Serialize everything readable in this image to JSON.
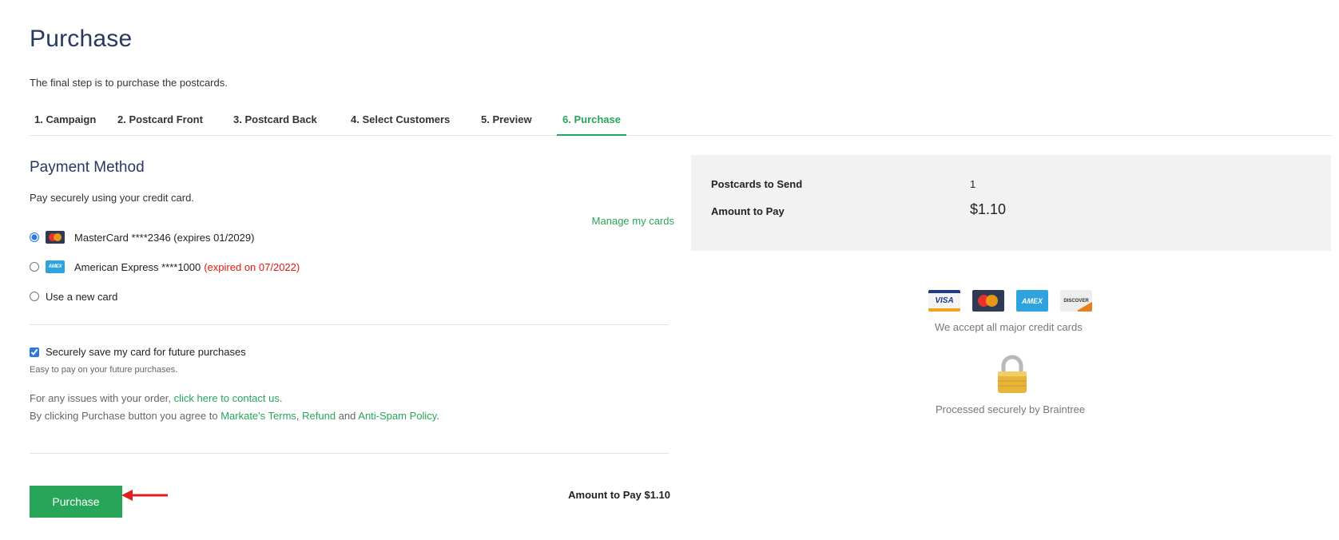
{
  "page": {
    "title": "Purchase",
    "intro": "The final step is to purchase the postcards."
  },
  "steps": [
    {
      "label": "1. Campaign",
      "active": false
    },
    {
      "label": "2. Postcard Front",
      "active": false
    },
    {
      "label": "3. Postcard Back",
      "active": false
    },
    {
      "label": "4. Select Customers",
      "active": false
    },
    {
      "label": "5. Preview",
      "active": false
    },
    {
      "label": "6. Purchase",
      "active": true
    }
  ],
  "payment": {
    "title": "Payment Method",
    "subtitle": "Pay securely using your credit card.",
    "manage_link": "Manage my cards",
    "options": [
      {
        "label": "MasterCard ****2346 (expires 01/2029)",
        "brand": "mastercard",
        "selected": true,
        "expired_note": ""
      },
      {
        "label": "American Express ****1000",
        "brand": "amex",
        "selected": false,
        "expired_note": "(expired on 07/2022)"
      },
      {
        "label": "Use a new card",
        "brand": "",
        "selected": false,
        "expired_note": ""
      }
    ],
    "save_card_label": "Securely save my card for future purchases",
    "save_card_checked": true,
    "save_card_sub": "Easy to pay on your future purchases."
  },
  "legal": {
    "issues_prefix": "For any issues with your order, ",
    "issues_link": "click here to contact us",
    "issues_suffix": ".",
    "agree_prefix": "By clicking Purchase button you agree to ",
    "terms_link": "Markate's Terms",
    "comma": ", ",
    "refund_link": "Refund",
    "and": " and ",
    "antispam_link": "Anti-Spam Policy",
    "period": "."
  },
  "actions": {
    "purchase_label": "Purchase",
    "amount_label": "Amount to Pay $1.10"
  },
  "summary": {
    "postcards_label": "Postcards to Send",
    "postcards_value": "1",
    "amount_label": "Amount to Pay",
    "amount_value": "$1.10"
  },
  "badges": {
    "visa": "VISA",
    "mastercard": "MasterCard",
    "amex": "AMEX",
    "discover": "DISCOVER",
    "accept_text": "We accept all major credit cards",
    "processed_text": "Processed securely by Braintree"
  },
  "colors": {
    "accent": "#27a65a",
    "title": "#263a5e",
    "error": "#e0190f",
    "arrow": "#e02020"
  }
}
